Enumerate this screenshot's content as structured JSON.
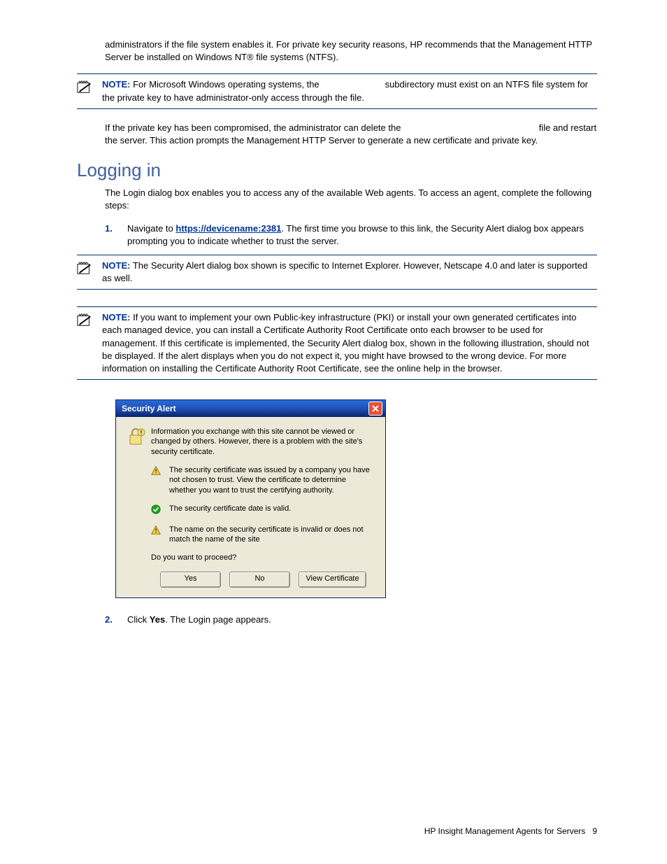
{
  "intro_para": "administrators if the file system enables it. For private key security reasons, HP recommends that the Management HTTP Server be installed on Windows NT® file systems (NTFS).",
  "note_label": "NOTE:",
  "note1": "For Microsoft Windows operating systems, the                          subdirectory must exist on an NTFS file system for the private key to have administrator-only access through the file.",
  "para_after_note1_a": "If the private key has been compromised, the administrator can delete the ",
  "para_after_note1_b": " file and restart the server. This action prompts the Management HTTP Server to generate a new certificate and private key.",
  "heading": "Logging in",
  "login_intro": "The Login dialog box enables you to access any of the available Web agents. To access an agent, complete the following steps:",
  "step1_num": "1.",
  "step1_a": "Navigate to ",
  "step1_link": "https://devicename:2381",
  "step1_b": ". The first time you browse to this link, the Security Alert dialog box appears prompting you to indicate whether to trust the server.",
  "note2": "The Security Alert dialog box shown is specific to Internet Explorer. However, Netscape 4.0 and later is supported as well.",
  "note3": "If you want to implement your own Public-key infrastructure (PKI) or install your own generated certificates into each managed device, you can install a Certificate Authority Root Certificate onto each browser to be used for management. If this certificate is implemented, the Security Alert dialog box, shown in the following illustration, should not be displayed. If the alert displays when you do not expect it, you might have browsed to the wrong device. For more information on installing the Certificate Authority Root Certificate, see the online help in the browser.",
  "dialog": {
    "title": "Security Alert",
    "main": "Information you exchange with this site cannot be viewed or changed by others. However, there is a problem with the site's security certificate.",
    "item1": "The security certificate was issued by a company you have not chosen to trust. View the certificate to determine whether you want to trust the certifying authority.",
    "item2": "The security certificate date is valid.",
    "item3": "The name on the security certificate is invalid or does not match the name of the site",
    "proceed": "Do you want to proceed?",
    "btn_yes": "Yes",
    "btn_no": "No",
    "btn_view": "View Certificate"
  },
  "step2_num": "2.",
  "step2_a": "Click ",
  "step2_bold": "Yes",
  "step2_b": ". The Login page appears.",
  "footer_text": "HP Insight Management Agents for Servers",
  "footer_page": "9"
}
